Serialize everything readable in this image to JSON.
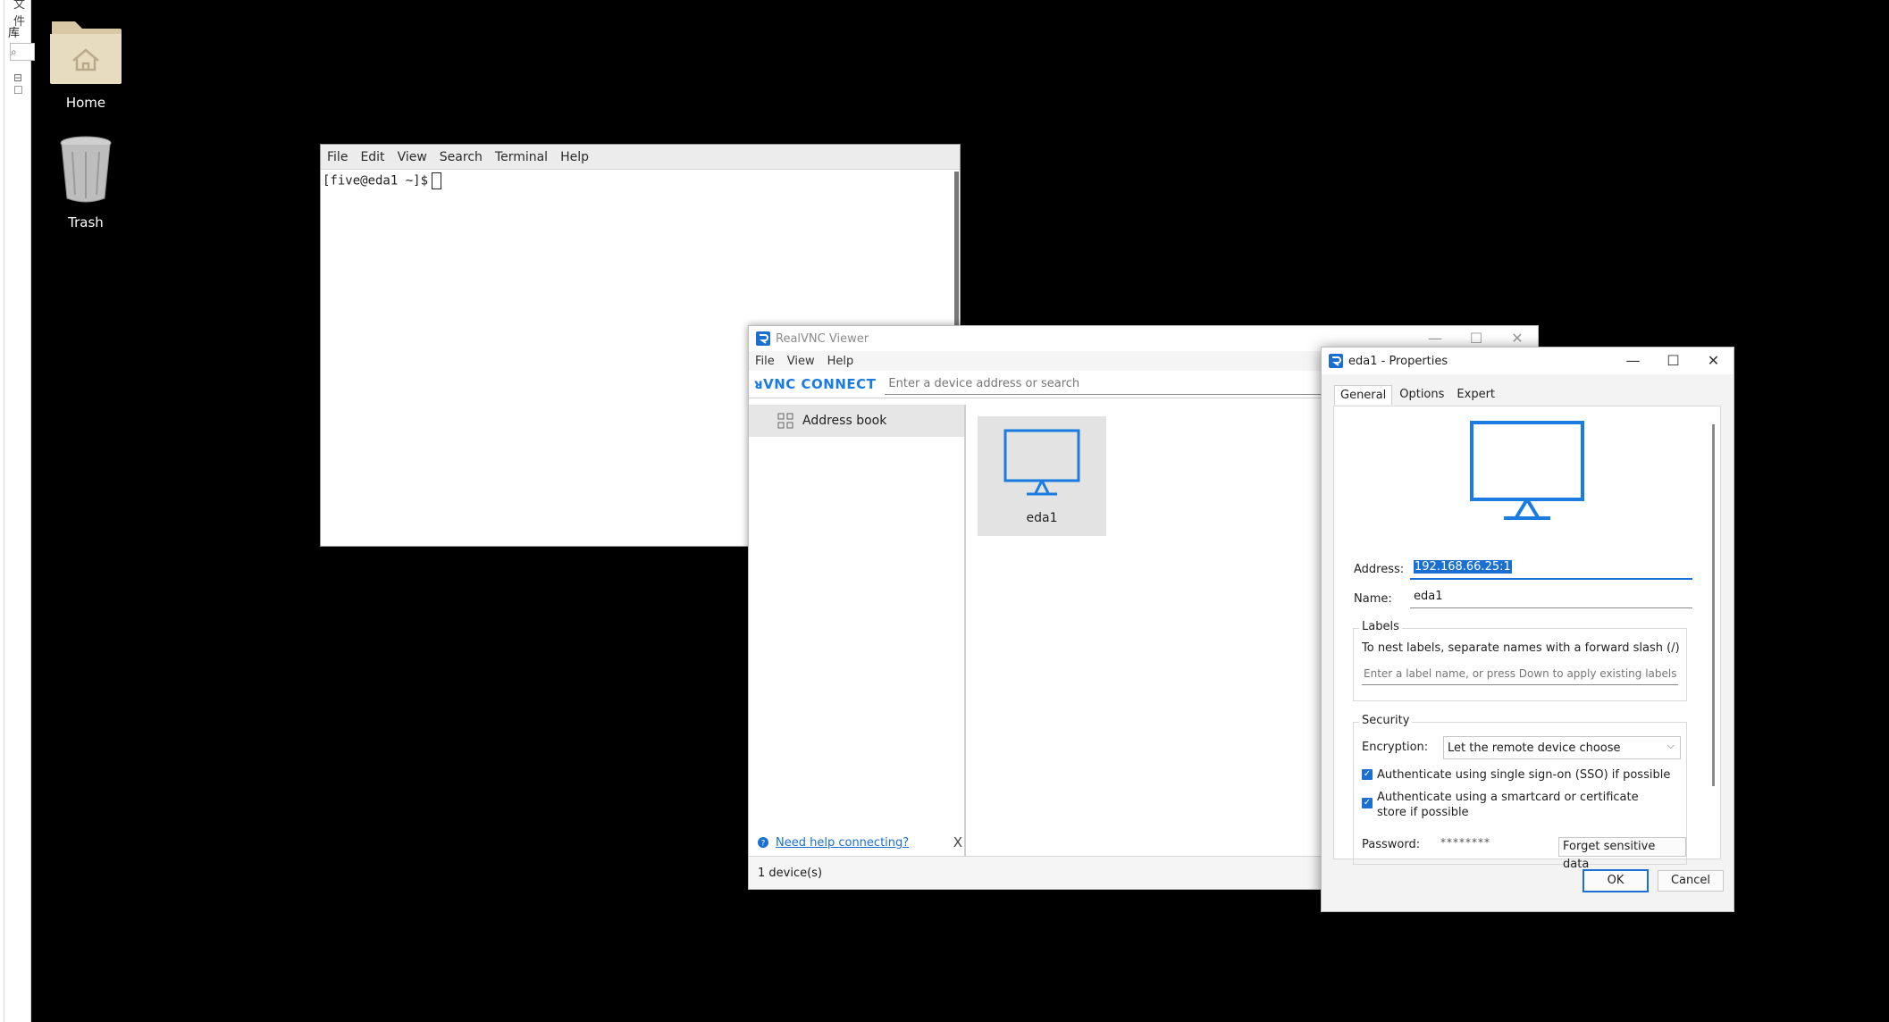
{
  "background_window": {
    "title_fragment": "文件",
    "lib_label": "库",
    "search_glyph": "⌕",
    "tree_glyph": "⊟ ☐"
  },
  "desktop": {
    "icons": [
      {
        "label": "Home"
      },
      {
        "label": "Trash"
      }
    ]
  },
  "terminal": {
    "menu": [
      "File",
      "Edit",
      "View",
      "Search",
      "Terminal",
      "Help"
    ],
    "prompt": "[five@eda1 ~]$"
  },
  "vnc_viewer": {
    "title": "RealVNC Viewer",
    "menu": [
      "File",
      "View",
      "Help"
    ],
    "logo_text": "ᴚVNC CONNECT",
    "search_placeholder": "Enter a device address or search",
    "sidebar_item": "Address book",
    "device_name": "eda1",
    "help_link": "Need help connecting?",
    "help_close": "X",
    "status": "1 device(s)",
    "colors": {
      "accent": "#1a7be0"
    }
  },
  "properties": {
    "title": "eda1 - Properties",
    "tabs": [
      "General",
      "Options",
      "Expert"
    ],
    "address_label": "Address:",
    "address_value": "192.168.66.25:1",
    "name_label": "Name:",
    "name_value": "eda1",
    "labels_group": "Labels",
    "labels_hint": "To nest labels, separate names with a forward slash (/)",
    "labels_placeholder": "Enter a label name, or press Down to apply existing labels",
    "security_group": "Security",
    "encryption_label": "Encryption:",
    "encryption_value": "Let the remote device choose",
    "sso_label": "Authenticate using single sign-on (SSO) if possible",
    "smartcard_label": "Authenticate using a smartcard or certificate store if possible",
    "password_label": "Password:",
    "password_value": "********",
    "forget_button": "Forget sensitive data",
    "ok_button": "OK",
    "cancel_button": "Cancel"
  }
}
